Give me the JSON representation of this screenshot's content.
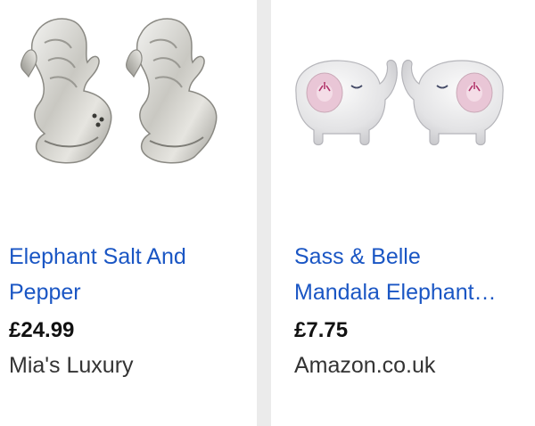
{
  "products": [
    {
      "title_line1": "Elephant Salt And",
      "title_line2": "Pepper",
      "price": "£24.99",
      "seller": "Mia's Luxury",
      "image": "silver-elephant-salt-pepper-shakers"
    },
    {
      "title_line1": "Sass & Belle",
      "title_line2": "Mandala Elephant…",
      "price": "£7.75",
      "seller": "Amazon.co.uk",
      "image": "grey-ceramic-elephant-shakers"
    }
  ],
  "colors": {
    "link": "#1a56c4",
    "price": "#111111",
    "seller": "#333333",
    "divider": "#ebebeb"
  }
}
